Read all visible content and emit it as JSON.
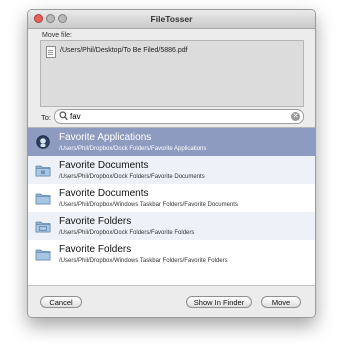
{
  "window": {
    "title": "FileTosser"
  },
  "move_file": {
    "label": "Move file:",
    "path": "/Users/Phil/Desktop/To Be Filed/5886.pdf"
  },
  "destination": {
    "label": "To:",
    "query": "fav",
    "search_icon": "magnifier-icon",
    "clear_icon": "clear-x-icon"
  },
  "results": [
    {
      "title": "Favorite Applications",
      "path": "/Users/Phil/Dropbox/Dock Folders/Favorite Applications",
      "icon": "applications-folder-icon",
      "selected": true
    },
    {
      "title": "Favorite Documents",
      "path": "/Users/Phil/Dropbox/Dock Folders/Favorite Documents",
      "icon": "folder-icon",
      "selected": false
    },
    {
      "title": "Favorite Documents",
      "path": "/Users/Phil/Dropbox/Windows Taskbar Folders/Favorite Documents",
      "icon": "folder-icon",
      "selected": false
    },
    {
      "title": "Favorite Folders",
      "path": "/Users/Phil/Dropbox/Dock Folders/Favorite Folders",
      "icon": "folder-icon",
      "selected": false
    },
    {
      "title": "Favorite Folders",
      "path": "/Users/Phil/Dropbox/Windows Taskbar Folders/Favorite Folders",
      "icon": "folder-icon",
      "selected": false
    }
  ],
  "buttons": {
    "cancel": "Cancel",
    "show_in_finder": "Show In Finder",
    "move": "Move"
  },
  "colors": {
    "selection": "#8c9bbf",
    "alt_row": "#eef2f8",
    "close_button": "#ec5f57"
  }
}
